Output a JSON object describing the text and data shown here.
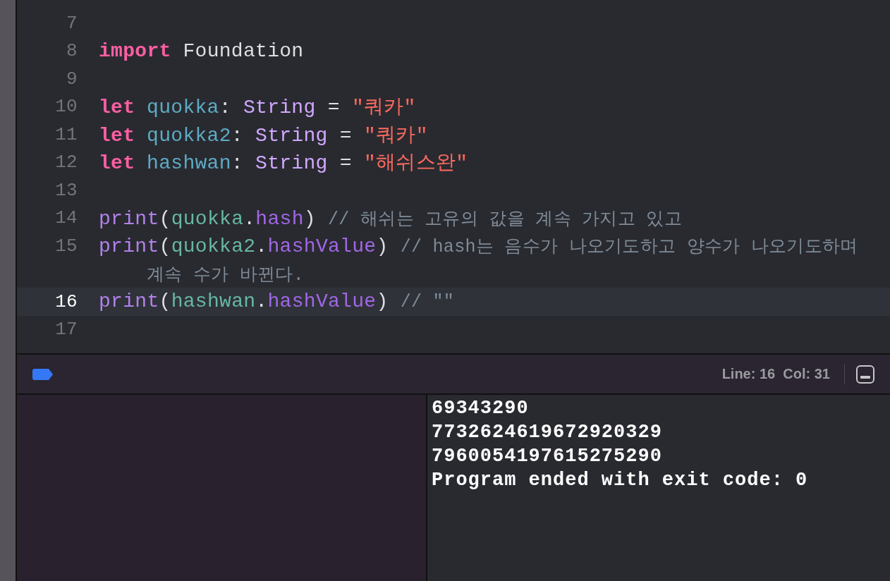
{
  "editor": {
    "lines": [
      {
        "number": "7",
        "current": false
      },
      {
        "number": "8",
        "current": false,
        "tokens": [
          {
            "kind": "keyword",
            "text": "import"
          },
          {
            "kind": "plain",
            "text": "Foundation"
          }
        ]
      },
      {
        "number": "9",
        "current": false
      },
      {
        "number": "10",
        "current": false,
        "tokens": [
          {
            "kind": "keyword",
            "text": "let"
          },
          {
            "kind": "decl",
            "text": "quokka"
          },
          {
            "kind": "plain",
            "text": ": "
          },
          {
            "kind": "type",
            "text": "String"
          },
          {
            "kind": "plain",
            "text": " = "
          },
          {
            "kind": "string",
            "text": "\"쿼카\""
          }
        ]
      },
      {
        "number": "11",
        "current": false,
        "tokens": [
          {
            "kind": "keyword",
            "text": "let"
          },
          {
            "kind": "decl",
            "text": "quokka2"
          },
          {
            "kind": "plain",
            "text": ": "
          },
          {
            "kind": "type",
            "text": "String"
          },
          {
            "kind": "plain",
            "text": " = "
          },
          {
            "kind": "string",
            "text": "\"쿼카\""
          }
        ]
      },
      {
        "number": "12",
        "current": false,
        "tokens": [
          {
            "kind": "keyword",
            "text": "let"
          },
          {
            "kind": "decl",
            "text": "hashwan"
          },
          {
            "kind": "plain",
            "text": ": "
          },
          {
            "kind": "type",
            "text": "String"
          },
          {
            "kind": "plain",
            "text": " = "
          },
          {
            "kind": "string",
            "text": "\"해쉬스완\""
          }
        ]
      },
      {
        "number": "13",
        "current": false
      },
      {
        "number": "14",
        "current": false,
        "tokens": [
          {
            "kind": "func",
            "text": "print"
          },
          {
            "kind": "plain",
            "text": "("
          },
          {
            "kind": "var",
            "text": "quokka"
          },
          {
            "kind": "plain",
            "text": "."
          },
          {
            "kind": "member",
            "text": "hash"
          },
          {
            "kind": "plain",
            "text": ") "
          },
          {
            "kind": "comment",
            "text": "// 해쉬는 고유의 값을 계속 가지고 있고"
          }
        ]
      },
      {
        "number": "15",
        "current": false,
        "tokens": [
          {
            "kind": "func",
            "text": "print"
          },
          {
            "kind": "plain",
            "text": "("
          },
          {
            "kind": "var",
            "text": "quokka2"
          },
          {
            "kind": "plain",
            "text": "."
          },
          {
            "kind": "member",
            "text": "hashValue"
          },
          {
            "kind": "plain",
            "text": ") "
          },
          {
            "kind": "comment",
            "text": "// hash는 음수가 나오기도하고 양수가 나오기도하며"
          }
        ],
        "continuation": "계속 수가 바뀐다."
      },
      {
        "number": "16",
        "current": true,
        "tokens": [
          {
            "kind": "func",
            "text": "print"
          },
          {
            "kind": "plain",
            "text": "("
          },
          {
            "kind": "var",
            "text": "hashwan"
          },
          {
            "kind": "plain",
            "text": "."
          },
          {
            "kind": "member",
            "text": "hashValue"
          },
          {
            "kind": "plain",
            "text": ") "
          },
          {
            "kind": "comment",
            "text": "// \"\""
          }
        ]
      },
      {
        "number": "17",
        "current": false
      }
    ]
  },
  "status_bar": {
    "position": "Line: 16  Col: 31"
  },
  "console": {
    "output": [
      "69343290",
      "7732624619672920329",
      "7960054197615275290",
      "Program ended with exit code: 0"
    ]
  }
}
